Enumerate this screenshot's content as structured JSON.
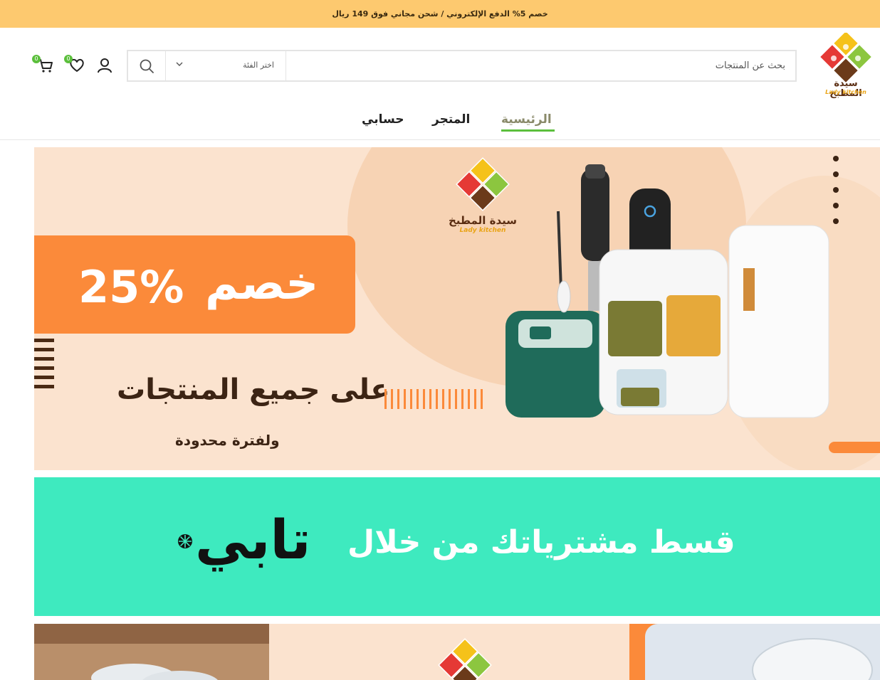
{
  "topbar": {
    "announcement": "خصم 5% الدفع الإلكتروني / شحن مجاني فوق 149 ريال"
  },
  "header": {
    "logo": {
      "name": "سيدة المطبخ",
      "subtitle": "Lady kitchen"
    },
    "search": {
      "placeholder": "بحث عن المنتجات",
      "category_label": "اختر الفئة"
    },
    "wishlist_count": "0",
    "cart_count": "0",
    "icons": {
      "account": "user-icon",
      "wishlist": "heart-icon",
      "cart": "cart-icon",
      "search": "search-icon"
    }
  },
  "nav": {
    "items": [
      {
        "label": "الرئيسية",
        "active": true
      },
      {
        "label": "المتجر",
        "active": false
      },
      {
        "label": "حسابي",
        "active": false
      }
    ]
  },
  "hero": {
    "discount_word": "خصم",
    "discount_value": "25%",
    "line1": "على جميع المنتجات",
    "line2": "ولفترة محدودة",
    "brand": "سيدة المطبخ",
    "brand_sub": "Lady kitchen"
  },
  "tabby": {
    "text": "قسط مشترياتك من خلال",
    "brand": "تابي"
  },
  "colors": {
    "topbar": "#fdc96f",
    "accent_green": "#5bbf3c",
    "hero_bg": "#fbe3cf",
    "hero_orange": "#fb8a3a",
    "tabby_bg": "#3eeabf",
    "brown": "#3c2414"
  }
}
